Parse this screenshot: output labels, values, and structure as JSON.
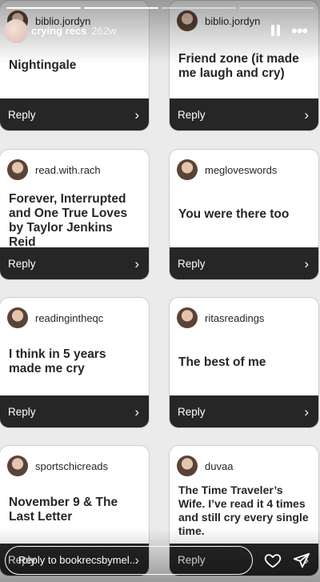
{
  "story": {
    "title": "crying recs",
    "time": "262w",
    "progress_segments": 4,
    "progress_completed": 2
  },
  "reply_label": "Reply",
  "cards": [
    {
      "username": "biblio.jordyn",
      "answer": "Nightingale"
    },
    {
      "username": "biblio.jordyn",
      "answer": "Friend zone (it made me laugh and cry)"
    },
    {
      "username": "read.with.rach",
      "answer": "Forever, Interrupted and One True Loves by Taylor Jenkins Reid"
    },
    {
      "username": "megloveswords",
      "answer": "You were there too"
    },
    {
      "username": "readingintheqc",
      "answer": "I think in 5 years made me cry"
    },
    {
      "username": "ritasreadings",
      "answer": "The best of me"
    },
    {
      "username": "sportschicreads",
      "answer": "November 9 & The Last Letter"
    },
    {
      "username": "duvaa",
      "answer": "The Time Traveler’s Wife. I’ve read it 4 times and still cry every single time."
    }
  ],
  "message_bar": {
    "placeholder": "Reply to bookrecsbymel..."
  }
}
